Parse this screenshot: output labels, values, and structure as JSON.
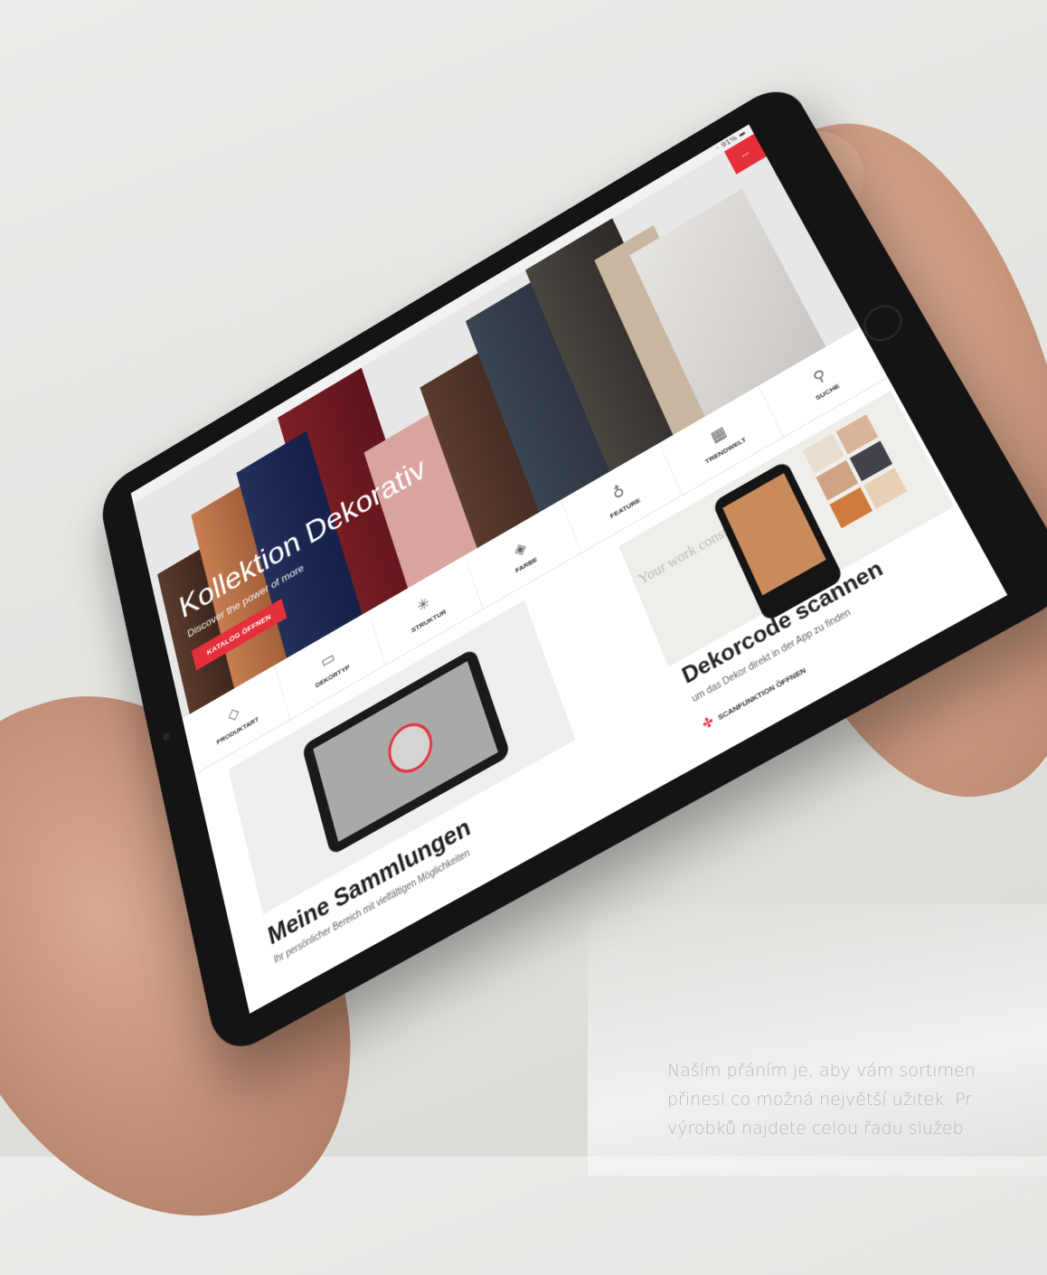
{
  "status_bar": {
    "text": "◦ 91% ▬"
  },
  "top_tab": {
    "label": "..."
  },
  "hero": {
    "title": "Kollektion Dekorativ",
    "subtitle": "Discover the power of more",
    "button": "KATALOG ÖFFNEN"
  },
  "nav": [
    {
      "label": "PRODUKTART",
      "icon": "layers-icon",
      "glyph": "◇"
    },
    {
      "label": "DEKORTYP",
      "icon": "box-icon",
      "glyph": "▭"
    },
    {
      "label": "STRUKTUR",
      "icon": "sparkle-icon",
      "glyph": "✳"
    },
    {
      "label": "FARBE",
      "icon": "palette-icon",
      "glyph": "◈"
    },
    {
      "label": "FEATURE",
      "icon": "feature-icon",
      "glyph": "♁"
    },
    {
      "label": "TRENDWELT",
      "icon": "trend-icon",
      "glyph": "▦"
    },
    {
      "label": "SUCHE",
      "icon": "search-icon",
      "glyph": "⚲"
    }
  ],
  "cards": {
    "collections": {
      "title": "Meine Sammlungen",
      "subtitle": "Ihr persönlicher Bereich mit vielfältigen Möglichkeiten"
    },
    "scan": {
      "title": "Dekorcode scannen",
      "subtitle": "um das Dekor direkt in der App zu finden",
      "link": "SCANFUNKTION ÖFFNEN",
      "poster_text": "Your work constant"
    }
  },
  "caption": {
    "line1": "Naším přáním je, aby vám sortimen",
    "line2": "přinesl co možná největší užitek. Pr",
    "line3": "výrobků najdete celou řadu služeb"
  },
  "colors": {
    "accent": "#e5303b"
  }
}
